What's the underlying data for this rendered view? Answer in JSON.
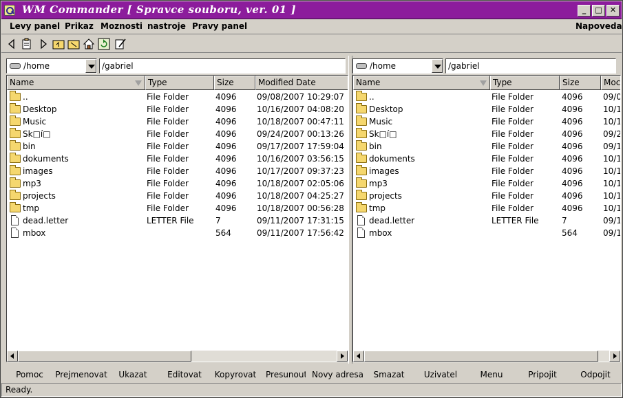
{
  "window": {
    "title": "WM Commander [ Spravce souboru, ver. 01 ]",
    "controls": {
      "minimize": "_",
      "maximize": "□",
      "close": "✕"
    },
    "title_color": "#8c1c9c"
  },
  "menu": {
    "left_panel": "Levy panel",
    "command": "Prikaz",
    "options": "Moznosti",
    "tools": "nastroje",
    "right_panel": "Pravy panel",
    "help": "Napoveda"
  },
  "toolbar": {
    "icons": [
      "back-icon",
      "clipboard-icon",
      "forward-icon",
      "folder-up-icon",
      "folder-open-icon",
      "home-icon",
      "refresh-icon",
      "edit-icon"
    ]
  },
  "columns": {
    "name": "Name",
    "type": "Type",
    "size": "Size",
    "modified": "Modified Date",
    "modified_short": "Moc"
  },
  "left": {
    "drive": "/home",
    "path": "/gabriel",
    "rows": [
      {
        "name": "..",
        "type": "File Folder",
        "size": "4096",
        "date": "09/08/2007 10:29:07",
        "icon": "folder"
      },
      {
        "name": "Desktop",
        "type": "File Folder",
        "size": "4096",
        "date": "10/16/2007 04:08:20",
        "icon": "folder"
      },
      {
        "name": "Music",
        "type": "File Folder",
        "size": "4096",
        "date": "10/18/2007 00:47:11",
        "icon": "folder"
      },
      {
        "name": "Sk□í□",
        "type": "File Folder",
        "size": "4096",
        "date": "09/24/2007 00:13:26",
        "icon": "folder"
      },
      {
        "name": "bin",
        "type": "File Folder",
        "size": "4096",
        "date": "09/17/2007 17:59:04",
        "icon": "folder"
      },
      {
        "name": "dokuments",
        "type": "File Folder",
        "size": "4096",
        "date": "10/16/2007 03:56:15",
        "icon": "folder"
      },
      {
        "name": "images",
        "type": "File Folder",
        "size": "4096",
        "date": "10/17/2007 09:37:23",
        "icon": "folder"
      },
      {
        "name": "mp3",
        "type": "File Folder",
        "size": "4096",
        "date": "10/18/2007 02:05:06",
        "icon": "folder"
      },
      {
        "name": "projects",
        "type": "File Folder",
        "size": "4096",
        "date": "10/18/2007 04:25:27",
        "icon": "folder"
      },
      {
        "name": "tmp",
        "type": "File Folder",
        "size": "4096",
        "date": "10/18/2007 00:56:28",
        "icon": "folder"
      },
      {
        "name": "dead.letter",
        "type": "LETTER File",
        "size": "7",
        "date": "09/11/2007 17:31:15",
        "icon": "file"
      },
      {
        "name": "mbox",
        "type": "",
        "size": "564",
        "date": "09/11/2007 17:56:42",
        "icon": "file"
      }
    ]
  },
  "right": {
    "drive": "/home",
    "path": "/gabriel",
    "rows": [
      {
        "name": "..",
        "type": "File Folder",
        "size": "4096",
        "date": "09/0",
        "icon": "folder"
      },
      {
        "name": "Desktop",
        "type": "File Folder",
        "size": "4096",
        "date": "10/1",
        "icon": "folder"
      },
      {
        "name": "Music",
        "type": "File Folder",
        "size": "4096",
        "date": "10/1",
        "icon": "folder"
      },
      {
        "name": "Sk□í□",
        "type": "File Folder",
        "size": "4096",
        "date": "09/2",
        "icon": "folder"
      },
      {
        "name": "bin",
        "type": "File Folder",
        "size": "4096",
        "date": "09/1",
        "icon": "folder"
      },
      {
        "name": "dokuments",
        "type": "File Folder",
        "size": "4096",
        "date": "10/1",
        "icon": "folder"
      },
      {
        "name": "images",
        "type": "File Folder",
        "size": "4096",
        "date": "10/1",
        "icon": "folder"
      },
      {
        "name": "mp3",
        "type": "File Folder",
        "size": "4096",
        "date": "10/1",
        "icon": "folder"
      },
      {
        "name": "projects",
        "type": "File Folder",
        "size": "4096",
        "date": "10/1",
        "icon": "folder"
      },
      {
        "name": "tmp",
        "type": "File Folder",
        "size": "4096",
        "date": "10/1",
        "icon": "folder"
      },
      {
        "name": "dead.letter",
        "type": "LETTER File",
        "size": "7",
        "date": "09/1",
        "icon": "file"
      },
      {
        "name": "mbox",
        "type": "",
        "size": "564",
        "date": "09/1",
        "icon": "file"
      }
    ]
  },
  "function_keys": [
    "Pomoc",
    "Prejmenovat",
    "Ukazat",
    "Editovat",
    "Kopyrovat",
    "Presunout",
    "Novy adresa",
    "Smazat",
    "Uzivatel",
    "Menu",
    "Pripojit",
    "Odpojit"
  ],
  "status": "Ready."
}
